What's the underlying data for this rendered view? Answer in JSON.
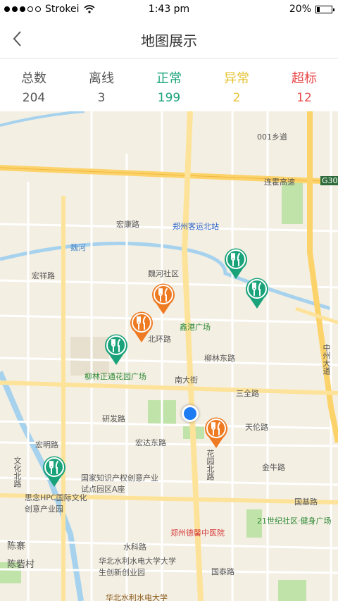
{
  "status_bar": {
    "carrier": "Strokei",
    "time": "1:43 pm",
    "battery": "20%"
  },
  "nav": {
    "title": "地图展示"
  },
  "stats": [
    {
      "label": "总数",
      "value": "204",
      "color": "#555555"
    },
    {
      "label": "离线",
      "value": "3",
      "color": "#555555"
    },
    {
      "label": "正常",
      "value": "199",
      "color": "#1aa37a"
    },
    {
      "label": "异常",
      "value": "2",
      "color": "#e6c233"
    },
    {
      "label": "超标",
      "value": "12",
      "color": "#e84b4b"
    }
  ],
  "map": {
    "labels": {
      "l1": "001乡道",
      "l2": "连霍高速",
      "l3": "G30",
      "l4": "宏康路",
      "l5": "郑州客运北站",
      "l6": "魏河",
      "l7": "魏河社区",
      "l8": "鑫港广场",
      "l9": "北环路",
      "l10": "柳林东路",
      "l11": "柳林正通花园广场",
      "l12": "南大街",
      "l13": "三全路",
      "l14": "研发路",
      "l15": "宏达东路",
      "l16": "天伦路",
      "l17": "宏明路",
      "l18": "国家知识产权创意产业试点园区A座",
      "l19": "金牛路",
      "l20": "思念HPC国际文化创意产业园",
      "l21": "国基路",
      "l22": "21世纪社区·健身广场",
      "l23": "郑州德馨中医院",
      "l24": "陈寨",
      "l25": "水科路",
      "l26": "华北水利水电大学大学生创新创业园",
      "l27": "华北水利水电大学",
      "l28": "陈砦村",
      "l29": "国泰路",
      "l30": "中州大道",
      "l31": "文化北路",
      "l32": "宏祥路",
      "l33": "花园北路"
    },
    "pins": [
      {
        "status": "正常",
        "color": "#1aa37a"
      },
      {
        "status": "正常",
        "color": "#1aa37a"
      },
      {
        "status": "异常",
        "color": "#ee7a22"
      },
      {
        "status": "异常",
        "color": "#ee7a22"
      },
      {
        "status": "正常",
        "color": "#1aa37a"
      },
      {
        "status": "异常",
        "color": "#ee7a22"
      },
      {
        "status": "正常",
        "color": "#1aa37a"
      }
    ]
  }
}
